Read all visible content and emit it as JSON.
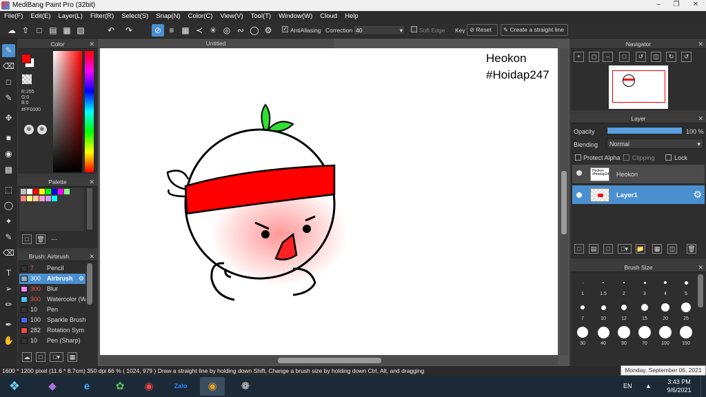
{
  "window": {
    "title": "MediBang Paint Pro (32bit)"
  },
  "menu": [
    "File(F)",
    "Edit(E)",
    "Layer(L)",
    "Filter(R)",
    "Select(S)",
    "Snap(N)",
    "Color(C)",
    "View(V)",
    "Tool(T)",
    "Window(W)",
    "Cloud",
    "Help"
  ],
  "toolbar": {
    "antialiasing": "AntiAliasing",
    "correction_label": "Correction",
    "correction_value": "40",
    "soft_edge": "Soft Edge",
    "key_label": "Key",
    "reset_label": "Reset",
    "straight_line_label": "Create a straight line"
  },
  "color_panel": {
    "title": "Color",
    "r": "R:255",
    "g": "G:0",
    "b": "B:0",
    "hex": "#FF0000",
    "fg": "#FF0000",
    "bg": "#FFFFFF"
  },
  "palette_panel": {
    "title": "Palette",
    "swatches": [
      "#c0c0c0",
      "#ffffff",
      "#ff0000",
      "#ffff00",
      "#00ff00",
      "#0000ff",
      "#ff00ff",
      "#80ff80",
      "#ff8080",
      "#ffff80",
      "#ffcc99",
      "#ff99cc",
      "#cc99ff",
      "#00ffff"
    ],
    "dashes": "---"
  },
  "brush_panel": {
    "title": "Brush: Airbrush",
    "items": [
      {
        "size": "7",
        "name": "Pencil",
        "color": "#333333"
      },
      {
        "size": "300",
        "name": "Airbrush",
        "color": "#9ab"
      },
      {
        "size": "300",
        "name": "Blur",
        "color": "#ff88ff"
      },
      {
        "size": "300",
        "name": "Watercolor (W",
        "color": "#44ccff"
      },
      {
        "size": "10",
        "name": "Pen",
        "color": "#333333"
      },
      {
        "size": "100",
        "name": "Sparkle Brush",
        "color": "#4466ff"
      },
      {
        "size": "282",
        "name": "Rotation Sym",
        "color": "#ff4444"
      },
      {
        "size": "10",
        "name": "Pen (Sharp)",
        "color": "#333333"
      }
    ]
  },
  "document": {
    "tab": "Untitled",
    "text1": "Heokon",
    "text2": "#Hoidap247"
  },
  "navigator": {
    "title": "Navigator"
  },
  "layer_panel": {
    "title": "Layer",
    "opacity_label": "Opacity",
    "opacity_value": "100 %",
    "blending_label": "Blending",
    "blending_value": "Normal",
    "protect_alpha": "Protect Alpha",
    "clipping": "Clipping",
    "lock": "Lock",
    "layers": [
      {
        "name": "Heokon",
        "selected": false
      },
      {
        "name": "Layer1",
        "selected": true
      }
    ]
  },
  "brush_size_panel": {
    "title": "Brush Size",
    "sizes": [
      "1",
      "1.5",
      "2",
      "3",
      "4",
      "5",
      "7",
      "10",
      "12",
      "15",
      "20",
      "25",
      "30",
      "40",
      "50",
      "70",
      "100",
      "150"
    ]
  },
  "status": {
    "text": "1600 * 1200 pixel   (11.6 * 8.7cm)   350 dpi   66 %   ( 1024, 979 )   Draw a straight line by holding down Shift, Change a brush size by holding down Ctrl, Alt, and dragging"
  },
  "tooltip": "Monday, September 06, 2021",
  "taskbar": {
    "lang": "EN",
    "time": "3:43 PM",
    "date": "9/6/2021",
    "apps": [
      "start",
      "visual-studio",
      "internet-explorer",
      "coccoc",
      "chrome",
      "zalo",
      "medibang",
      "paint-app"
    ]
  }
}
